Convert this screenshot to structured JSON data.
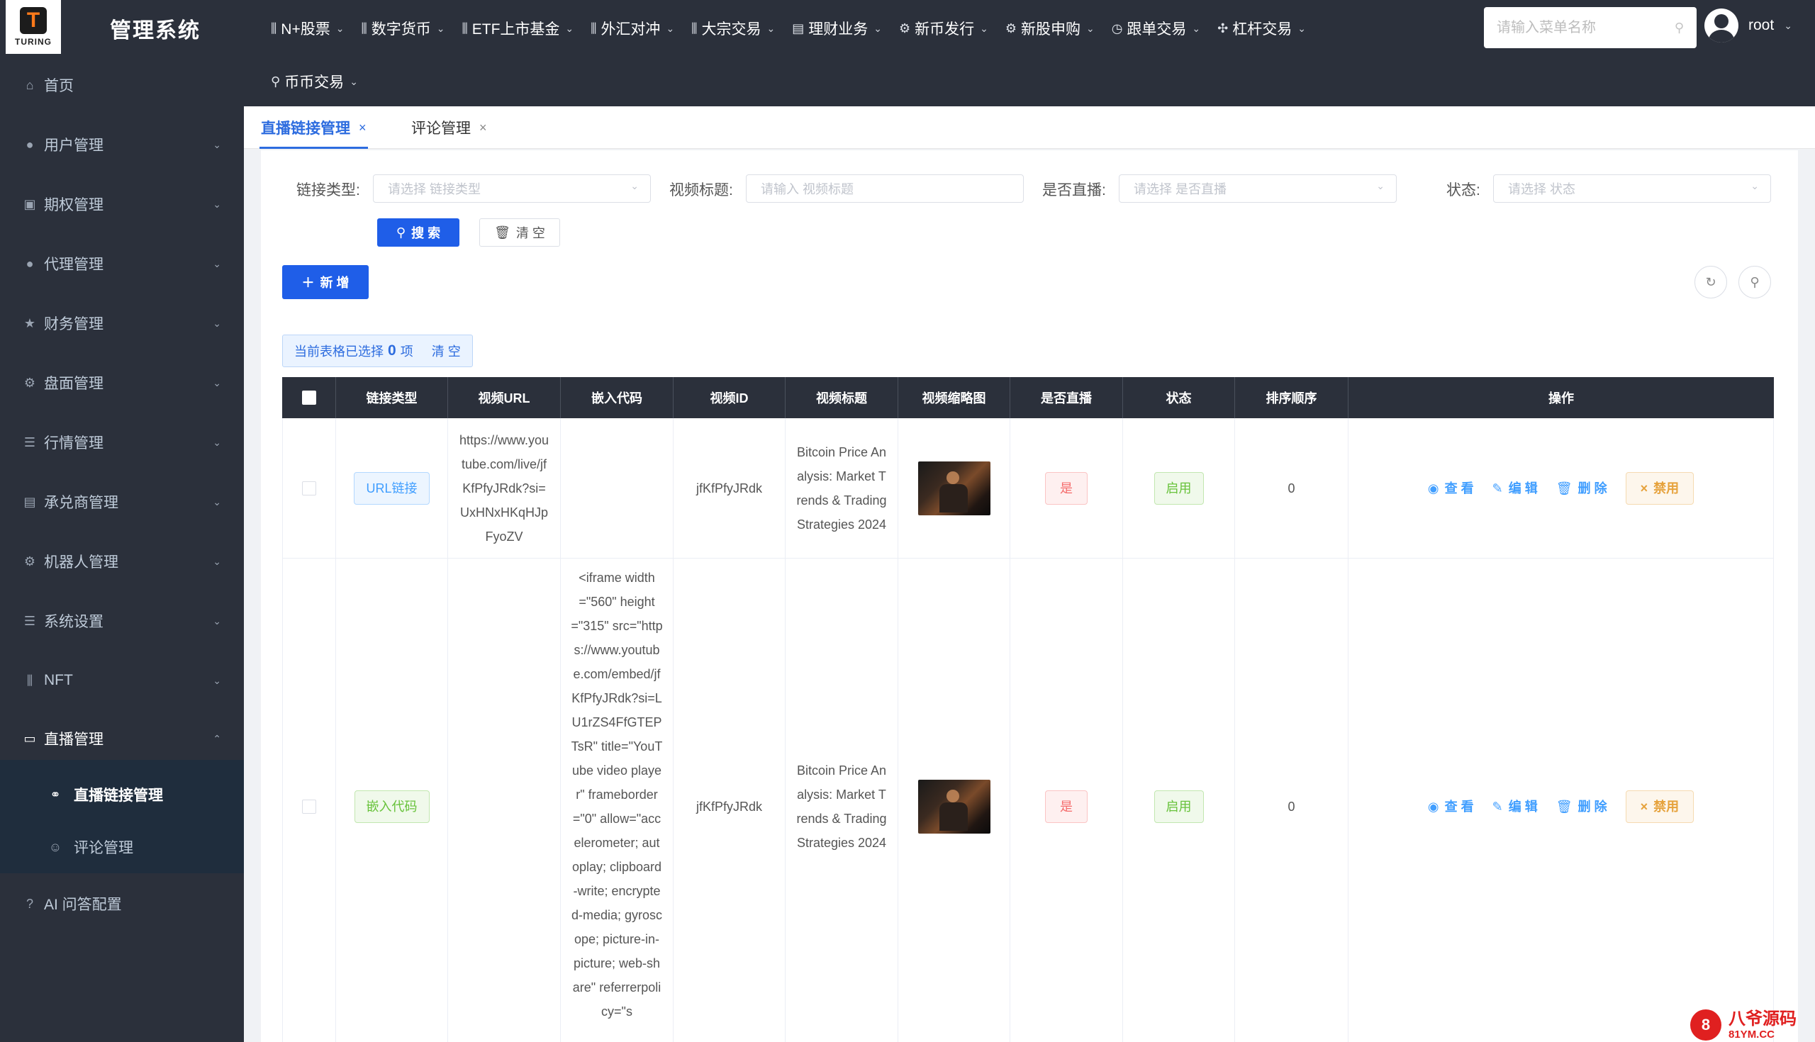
{
  "brand": {
    "logo_letter": "T",
    "logo_text": "TURING",
    "app_title": "管理系统"
  },
  "top_nav": [
    {
      "label": "N+股票",
      "icon": "bar-chart-icon"
    },
    {
      "label": "数字货币",
      "icon": "bar-chart-icon"
    },
    {
      "label": "ETF上市基金",
      "icon": "bar-chart-icon"
    },
    {
      "label": "外汇对冲",
      "icon": "bar-chart-icon"
    },
    {
      "label": "大宗交易",
      "icon": "bar-chart-icon"
    },
    {
      "label": "理财业务",
      "icon": "document-icon"
    },
    {
      "label": "新币发行",
      "icon": "gear-icon"
    },
    {
      "label": "新股申购",
      "icon": "gear-icon"
    },
    {
      "label": "跟单交易",
      "icon": "clock-icon"
    },
    {
      "label": "杠杆交易",
      "icon": "tools-icon"
    },
    {
      "label": "币币交易",
      "icon": "pin-icon"
    }
  ],
  "menu_search": {
    "placeholder": "请输入菜单名称"
  },
  "user": {
    "name": "root"
  },
  "sidebar": {
    "items": [
      {
        "label": "首页",
        "icon": "home-icon"
      },
      {
        "label": "用户管理",
        "icon": "user-icon"
      },
      {
        "label": "期权管理",
        "icon": "chart-box-icon"
      },
      {
        "label": "代理管理",
        "icon": "user-icon"
      },
      {
        "label": "财务管理",
        "icon": "star-icon"
      },
      {
        "label": "盘面管理",
        "icon": "gear-icon"
      },
      {
        "label": "行情管理",
        "icon": "list-icon"
      },
      {
        "label": "承兑商管理",
        "icon": "document-icon"
      },
      {
        "label": "机器人管理",
        "icon": "gear-icon"
      },
      {
        "label": "系统设置",
        "icon": "list-icon"
      },
      {
        "label": "NFT",
        "icon": "bar-chart-icon"
      },
      {
        "label": "直播管理",
        "icon": "video-icon"
      },
      {
        "label": "AI 问答配置",
        "icon": "question-icon"
      }
    ],
    "sub_items": [
      {
        "label": "直播链接管理",
        "icon": "link-icon"
      },
      {
        "label": "评论管理",
        "icon": "comment-icon"
      }
    ]
  },
  "tabs": [
    {
      "label": "直播链接管理",
      "active": true
    },
    {
      "label": "评论管理",
      "active": false
    }
  ],
  "filters": {
    "link_type": {
      "label": "链接类型:",
      "placeholder": "请选择 链接类型"
    },
    "video_title": {
      "label": "视频标题:",
      "placeholder": "请输入 视频标题"
    },
    "is_live": {
      "label": "是否直播:",
      "placeholder": "请选择 是否直播"
    },
    "status": {
      "label": "状态:",
      "placeholder": "请选择 状态"
    },
    "search_button": "搜 索",
    "clear_button": "清 空"
  },
  "toolbar": {
    "add_button": "新 增"
  },
  "selection": {
    "prefix": "当前表格已选择",
    "count": "0",
    "suffix": "项",
    "clear": "清 空"
  },
  "table": {
    "columns": [
      "链接类型",
      "视频URL",
      "嵌入代码",
      "视频ID",
      "视频标题",
      "视频缩略图",
      "是否直播",
      "状态",
      "排序顺序",
      "操作"
    ],
    "rows": [
      {
        "link_type": "URL链接",
        "video_url": "https://www.youtube.com/live/jfKfPfyJRdk?si=UxHNxHKqHJpFyoZV",
        "embed_code": "",
        "video_id": "jfKfPfyJRdk",
        "title": "Bitcoin Price Analysis: Market Trends & Trading Strategies 2024",
        "is_live": "是",
        "status": "启用",
        "sort_order": "0"
      },
      {
        "link_type": "嵌入代码",
        "video_url": "",
        "embed_code": "<iframe width=\"560\" height=\"315\" src=\"https://www.youtube.com/embed/jfKfPfyJRdk?si=LU1rZS4FfGTEPTsR\" title=\"YouTube video player\" frameborder=\"0\" allow=\"accelerometer; autoplay; clipboard-write; encrypted-media; gyroscope; picture-in-picture; web-share\" referrerpolicy=\"s",
        "video_id": "jfKfPfyJRdk",
        "title": "Bitcoin Price Analysis: Market Trends & Trading Strategies 2024",
        "is_live": "是",
        "status": "启用",
        "sort_order": "0"
      }
    ],
    "actions": {
      "view": "查 看",
      "edit": "编 辑",
      "delete": "删 除",
      "disable": "禁用"
    }
  },
  "watermark": {
    "badge": "8",
    "main": "八爷源码",
    "sub": "81YM.CC"
  },
  "colors": {
    "primary": "#1f5ee8",
    "sidebar_bg": "#2b303b",
    "link": "#409eff"
  }
}
